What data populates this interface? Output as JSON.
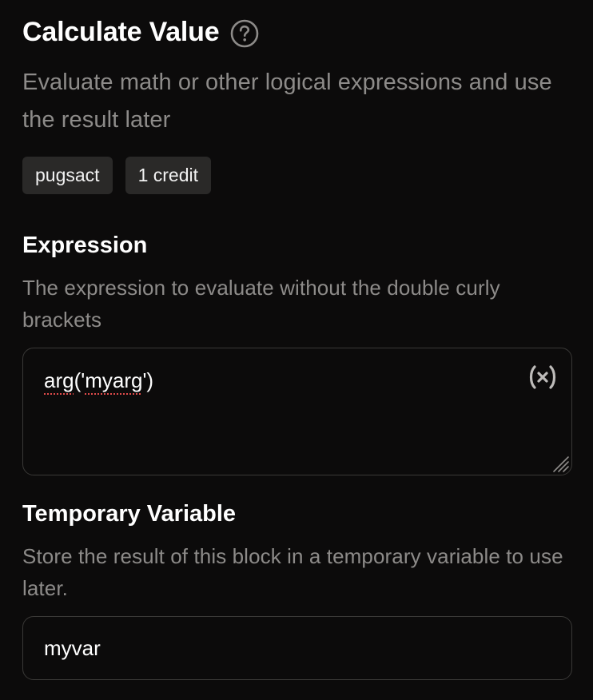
{
  "block": {
    "title": "Calculate Value",
    "description": "Evaluate math or other logical expressions and use the result later",
    "tags": [
      "pugsact",
      "1 credit"
    ]
  },
  "expression": {
    "label": "Expression",
    "help": "The expression to evaluate without the double curly brackets",
    "value_fn": "arg",
    "value_open": "('",
    "value_arg": "myarg",
    "value_close": "')",
    "icon": "variable-icon"
  },
  "temp_var": {
    "label": "Temporary Variable",
    "help": "Store the result of this block in a temporary variable to use later.",
    "value": "myvar"
  },
  "colors": {
    "background": "#0c0b0b",
    "muted_text": "#8d8b89",
    "tag_bg": "#2a2928",
    "border": "#3a3937",
    "spellcheck": "#e04b4b"
  }
}
